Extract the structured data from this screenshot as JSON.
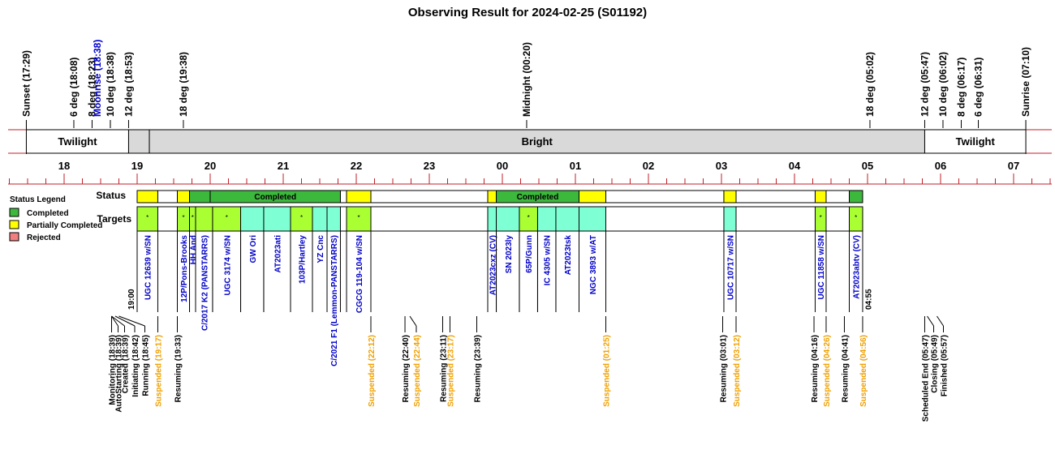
{
  "title": "Observing Result for 2024-02-25 (S01192)",
  "colors": {
    "red_line": "#c0202a",
    "twilight": "#ffffff",
    "bright": "#d9d9d9",
    "completed": "#3cb83c",
    "partial": "#ffff00",
    "rejected": "#f08080",
    "target_lime": "#aaff33",
    "target_aqua": "#7fffd4",
    "blue_text": "#0000c8",
    "orange_text": "#f0a000"
  },
  "sky_events": [
    {
      "label": "Sunset (17:29)",
      "hour": 17.483,
      "color": "black"
    },
    {
      "label": "6 deg (18:08)",
      "hour": 18.133,
      "color": "black"
    },
    {
      "label": "8 deg (18:23)",
      "hour": 18.383,
      "color": "black"
    },
    {
      "label": "Moonrise (18:38)",
      "hour": 18.633,
      "color": "blue"
    },
    {
      "label": "10 deg (18:38)",
      "hour": 18.633,
      "color": "black"
    },
    {
      "label": "12 deg (18:53)",
      "hour": 18.883,
      "color": "black"
    },
    {
      "label": "18 deg (19:38)",
      "hour": 19.633,
      "color": "black"
    },
    {
      "label": "Midnight (00:20)",
      "hour": 24.333,
      "color": "black"
    },
    {
      "label": "18 deg (05:02)",
      "hour": 29.033,
      "color": "black"
    },
    {
      "label": "12 deg (05:47)",
      "hour": 29.783,
      "color": "black"
    },
    {
      "label": "10 deg (06:02)",
      "hour": 30.033,
      "color": "black"
    },
    {
      "label": "8 deg (06:17)",
      "hour": 30.283,
      "color": "black"
    },
    {
      "label": "6 deg (06:31)",
      "hour": 30.517,
      "color": "black"
    },
    {
      "label": "Sunrise (07:10)",
      "hour": 31.167,
      "color": "black"
    }
  ],
  "bands": [
    {
      "label": "Twilight",
      "start": 17.483,
      "end": 18.883,
      "fill": "twilight"
    },
    {
      "label": "",
      "start": 18.883,
      "end": 19.167,
      "fill": "bright"
    },
    {
      "label": "Bright",
      "start": 19.167,
      "end": 29.783,
      "fill": "bright"
    },
    {
      "label": "Twilight",
      "start": 29.783,
      "end": 31.167,
      "fill": "twilight"
    }
  ],
  "hour_labels": [
    "18",
    "19",
    "20",
    "21",
    "22",
    "23",
    "00",
    "01",
    "02",
    "03",
    "04",
    "05",
    "06",
    "07"
  ],
  "hour_values": [
    18,
    19,
    20,
    21,
    22,
    23,
    24,
    25,
    26,
    27,
    28,
    29,
    30,
    31
  ],
  "row_labels": {
    "status": "Status",
    "targets": "Targets"
  },
  "legend": {
    "title": "Status Legend",
    "items": [
      {
        "label": "Completed",
        "color": "completed"
      },
      {
        "label": "Partially Completed",
        "color": "partial"
      },
      {
        "label": "Rejected",
        "color": "rejected"
      }
    ]
  },
  "chart_data": {
    "type": "timeline",
    "title": "Observing Result for 2024-02-25 (S01192)",
    "xlim": [
      17.16,
      31.56
    ],
    "status_segments": [
      {
        "start": 19.0,
        "end": 19.283,
        "status": "partial",
        "label": ""
      },
      {
        "start": 19.283,
        "end": 19.55,
        "status": "blank",
        "label": ""
      },
      {
        "start": 19.55,
        "end": 19.717,
        "status": "partial",
        "label": ""
      },
      {
        "start": 19.717,
        "end": 20.0,
        "status": "completed",
        "label": ""
      },
      {
        "start": 20.0,
        "end": 21.783,
        "status": "completed",
        "label": "Completed"
      },
      {
        "start": 21.783,
        "end": 21.867,
        "status": "blank",
        "label": ""
      },
      {
        "start": 21.867,
        "end": 22.2,
        "status": "partial",
        "label": ""
      },
      {
        "start": 22.2,
        "end": 23.8,
        "status": "blank",
        "label": ""
      },
      {
        "start": 23.8,
        "end": 23.917,
        "status": "partial",
        "label": ""
      },
      {
        "start": 23.917,
        "end": 25.05,
        "status": "completed",
        "label": "Completed"
      },
      {
        "start": 25.05,
        "end": 25.417,
        "status": "partial",
        "label": ""
      },
      {
        "start": 25.417,
        "end": 27.033,
        "status": "blank",
        "label": ""
      },
      {
        "start": 27.033,
        "end": 27.2,
        "status": "partial",
        "label": ""
      },
      {
        "start": 27.2,
        "end": 28.283,
        "status": "blank",
        "label": ""
      },
      {
        "start": 28.283,
        "end": 28.433,
        "status": "partial",
        "label": ""
      },
      {
        "start": 28.433,
        "end": 28.75,
        "status": "blank",
        "label": ""
      },
      {
        "start": 28.75,
        "end": 28.933,
        "status": "completed",
        "label": ""
      }
    ],
    "targets": [
      {
        "name": "UGC 12639 w/SN",
        "start": 19.0,
        "end": 19.283,
        "fill": "lime",
        "star": true,
        "color": "blue"
      },
      {
        "name": "12P/Pons-Brooks",
        "start": 19.55,
        "end": 19.717,
        "fill": "lime",
        "star": true,
        "color": "blue"
      },
      {
        "name": "HH And",
        "start": 19.717,
        "end": 19.8,
        "fill": "lime",
        "star": true,
        "color": "blue"
      },
      {
        "name": "C/2017 K2 (PANSTARRS)",
        "start": 19.8,
        "end": 20.033,
        "fill": "lime",
        "star": false,
        "color": "blue"
      },
      {
        "name": "UGC 3174 w/SN",
        "start": 20.033,
        "end": 20.417,
        "fill": "lime",
        "star": true,
        "color": "blue"
      },
      {
        "name": "GW Ori",
        "start": 20.417,
        "end": 20.733,
        "fill": "aqua",
        "star": false,
        "color": "blue"
      },
      {
        "name": "AT2023ati",
        "start": 20.733,
        "end": 21.1,
        "fill": "aqua",
        "star": false,
        "color": "blue"
      },
      {
        "name": "103P/Hartley",
        "start": 21.1,
        "end": 21.4,
        "fill": "lime",
        "star": true,
        "color": "blue"
      },
      {
        "name": "YZ Cnc",
        "start": 21.4,
        "end": 21.6,
        "fill": "aqua",
        "star": false,
        "color": "blue"
      },
      {
        "name": "C/2021 F1 (Lemmon-PANSTARRS)",
        "start": 21.6,
        "end": 21.783,
        "fill": "aqua",
        "star": false,
        "color": "blue"
      },
      {
        "name": "CGCG 119-104 w/SN",
        "start": 21.867,
        "end": 22.2,
        "fill": "lime",
        "star": true,
        "color": "blue"
      },
      {
        "name": "AT2023cxz (CV)",
        "start": 23.8,
        "end": 23.917,
        "fill": "aqua",
        "star": false,
        "color": "blue"
      },
      {
        "name": "SN 2023ly",
        "start": 23.917,
        "end": 24.233,
        "fill": "aqua",
        "star": false,
        "color": "blue"
      },
      {
        "name": "65P/Gunn",
        "start": 24.233,
        "end": 24.483,
        "fill": "lime",
        "star": true,
        "color": "blue"
      },
      {
        "name": "IC 4305 w/SN",
        "start": 24.483,
        "end": 24.733,
        "fill": "aqua",
        "star": false,
        "color": "blue"
      },
      {
        "name": "AT2023tsk",
        "start": 24.733,
        "end": 25.05,
        "fill": "aqua",
        "star": false,
        "color": "blue"
      },
      {
        "name": "NGC 3893 w/AT",
        "start": 25.05,
        "end": 25.417,
        "fill": "aqua",
        "star": false,
        "color": "blue"
      },
      {
        "name": "UGC 10717 w/SN",
        "start": 27.033,
        "end": 27.2,
        "fill": "aqua",
        "star": false,
        "color": "blue"
      },
      {
        "name": "UGC 11858 w/SN",
        "start": 28.283,
        "end": 28.433,
        "fill": "lime",
        "star": true,
        "color": "blue"
      },
      {
        "name": "AT2023abtv (CV)",
        "start": 28.75,
        "end": 28.933,
        "fill": "lime",
        "star": true,
        "color": "blue"
      }
    ],
    "window_labels": [
      {
        "label": "19:00",
        "hour": 19.0
      },
      {
        "label": "04:55",
        "hour": 28.917
      }
    ],
    "events": [
      {
        "label": "Monitoring (18:39)",
        "hour": 18.65,
        "color": "black"
      },
      {
        "label": "AutoStarting (18:39)",
        "hour": 18.65,
        "color": "black"
      },
      {
        "label": "Created (18:39)",
        "hour": 18.65,
        "color": "black"
      },
      {
        "label": "Initiating (18:42)",
        "hour": 18.7,
        "color": "black"
      },
      {
        "label": "Running (18:45)",
        "hour": 18.75,
        "color": "black"
      },
      {
        "label": "Suspended (19:17)",
        "hour": 19.283,
        "color": "orange"
      },
      {
        "label": "Resuming (19:33)",
        "hour": 19.55,
        "color": "black"
      },
      {
        "label": "Suspended (22:12)",
        "hour": 22.2,
        "color": "orange"
      },
      {
        "label": "Resuming (22:40)",
        "hour": 22.667,
        "color": "black"
      },
      {
        "label": "Suspended (22:44)",
        "hour": 22.733,
        "color": "orange"
      },
      {
        "label": "Resuming (23:11)",
        "hour": 23.183,
        "color": "black"
      },
      {
        "label": "Suspended (23:17)",
        "hour": 23.283,
        "color": "orange"
      },
      {
        "label": "Resuming (23:39)",
        "hour": 23.65,
        "color": "black"
      },
      {
        "label": "Suspended (01:25)",
        "hour": 25.417,
        "color": "orange"
      },
      {
        "label": "Resuming (03:01)",
        "hour": 27.017,
        "color": "black"
      },
      {
        "label": "Suspended (03:12)",
        "hour": 27.2,
        "color": "orange"
      },
      {
        "label": "Resuming (04:16)",
        "hour": 28.267,
        "color": "black"
      },
      {
        "label": "Suspended (04:26)",
        "hour": 28.433,
        "color": "orange"
      },
      {
        "label": "Resuming (04:41)",
        "hour": 28.683,
        "color": "black"
      },
      {
        "label": "Suspended (04:56)",
        "hour": 28.933,
        "color": "orange"
      },
      {
        "label": "Scheduled End (05:47)",
        "hour": 29.783,
        "color": "black"
      },
      {
        "label": "Closing (05:49)",
        "hour": 29.817,
        "color": "black"
      },
      {
        "label": "Finished (05:57)",
        "hour": 29.95,
        "color": "black"
      }
    ]
  }
}
